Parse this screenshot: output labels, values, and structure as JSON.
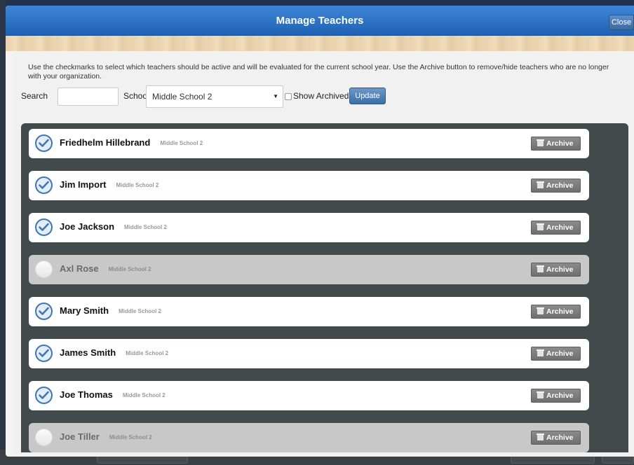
{
  "modal": {
    "title": "Manage Teachers",
    "close_label": "Close"
  },
  "instructions": "Use the checkmarks to select which teachers should be active and will be evaluated for the current school year. Use the Archive button to remove/hide teachers who are no longer with your organization.",
  "filters": {
    "search_label": "Search",
    "search_value": "",
    "school_label": "School",
    "school_selected": "Middle School 2",
    "show_archived_label": "Show Archived",
    "show_archived_checked": false,
    "update_label": "Update"
  },
  "archive_label": "Archive",
  "teachers": [
    {
      "name": "Friedhelm Hillebrand",
      "school": "Middle School 2",
      "active": true
    },
    {
      "name": "Jim Import",
      "school": "Middle School 2",
      "active": true
    },
    {
      "name": "Joe Jackson",
      "school": "Middle School 2",
      "active": true
    },
    {
      "name": "Axl Rose",
      "school": "Middle School 2",
      "active": false
    },
    {
      "name": "Mary Smith",
      "school": "Middle School 2",
      "active": true
    },
    {
      "name": "James Smith",
      "school": "Middle School 2",
      "active": true
    },
    {
      "name": "Joe Thomas",
      "school": "Middle School 2",
      "active": true
    },
    {
      "name": "Joe Tiller",
      "school": "Middle School 2",
      "active": false
    }
  ],
  "colors": {
    "header_blue": "#2a6fc4",
    "check_blue": "#3b77b8",
    "panel_dark": "#434a4b"
  }
}
